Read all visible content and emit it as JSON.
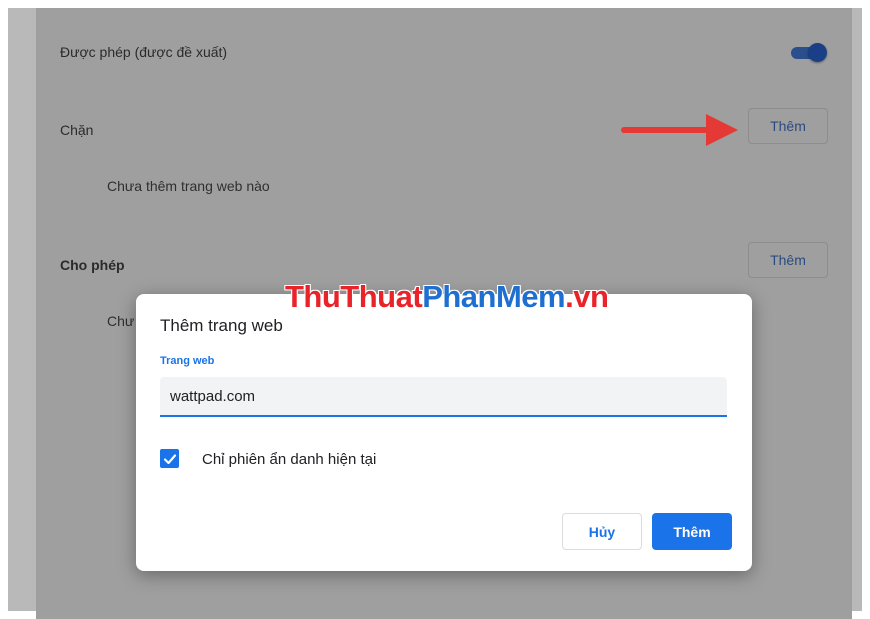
{
  "settings": {
    "allowed_recommended_label": "Được phép (được đề xuất)",
    "allowed_recommended_toggle_on": true,
    "block_section_title": "Chặn",
    "block_add_button": "Thêm",
    "block_empty_text": "Chưa thêm trang web nào",
    "allow_section_title": "Cho phép",
    "allow_add_button": "Thêm",
    "allow_empty_text_partial": "Chư"
  },
  "watermark": {
    "part1": "ThuThuat",
    "part2": "PhanMem",
    "part3": ".vn"
  },
  "dialog": {
    "title": "Thêm trang web",
    "field_label": "Trang web",
    "field_value": "wattpad.com",
    "checkbox_checked": true,
    "checkbox_label": "Chỉ phiên ẩn danh hiện tại",
    "cancel_button": "Hủy",
    "add_button": "Thêm"
  },
  "colors": {
    "accent": "#1a73e8",
    "arrow": "#e53935",
    "watermark_red": "#e8232a",
    "watermark_blue": "#1f6fd1"
  }
}
